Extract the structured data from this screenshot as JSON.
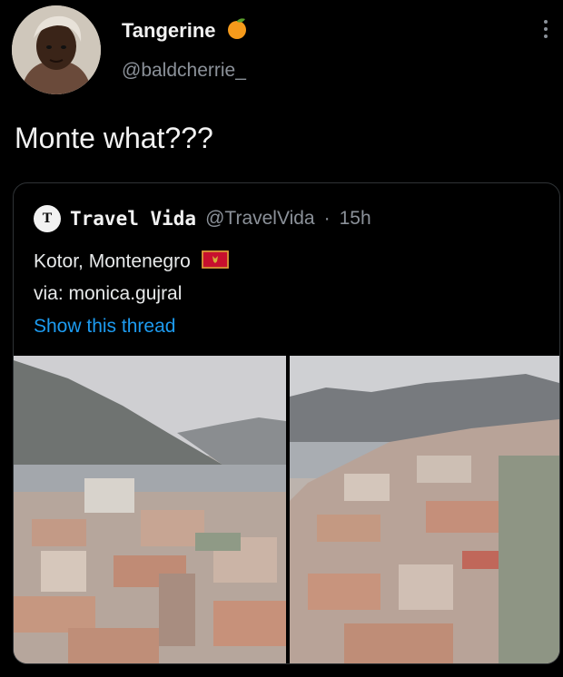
{
  "author": {
    "name": "Tangerine",
    "emoji": "tangerine-emoji-icon",
    "handle": "@baldcherrie_"
  },
  "tweet": {
    "text": "Monte what???"
  },
  "quoted": {
    "avatar_letter": "T",
    "name": "Travel Vida",
    "handle": "@TravelVida",
    "separator": "·",
    "time": "15h",
    "line1": "Kotor, Montenegro",
    "line1_flag": "montenegro-flag-icon",
    "line2": "via: monica.gujral",
    "thread_link": "Show this thread",
    "link_color": "#1d9bf0"
  },
  "icons": {
    "more": "more-options-icon"
  }
}
